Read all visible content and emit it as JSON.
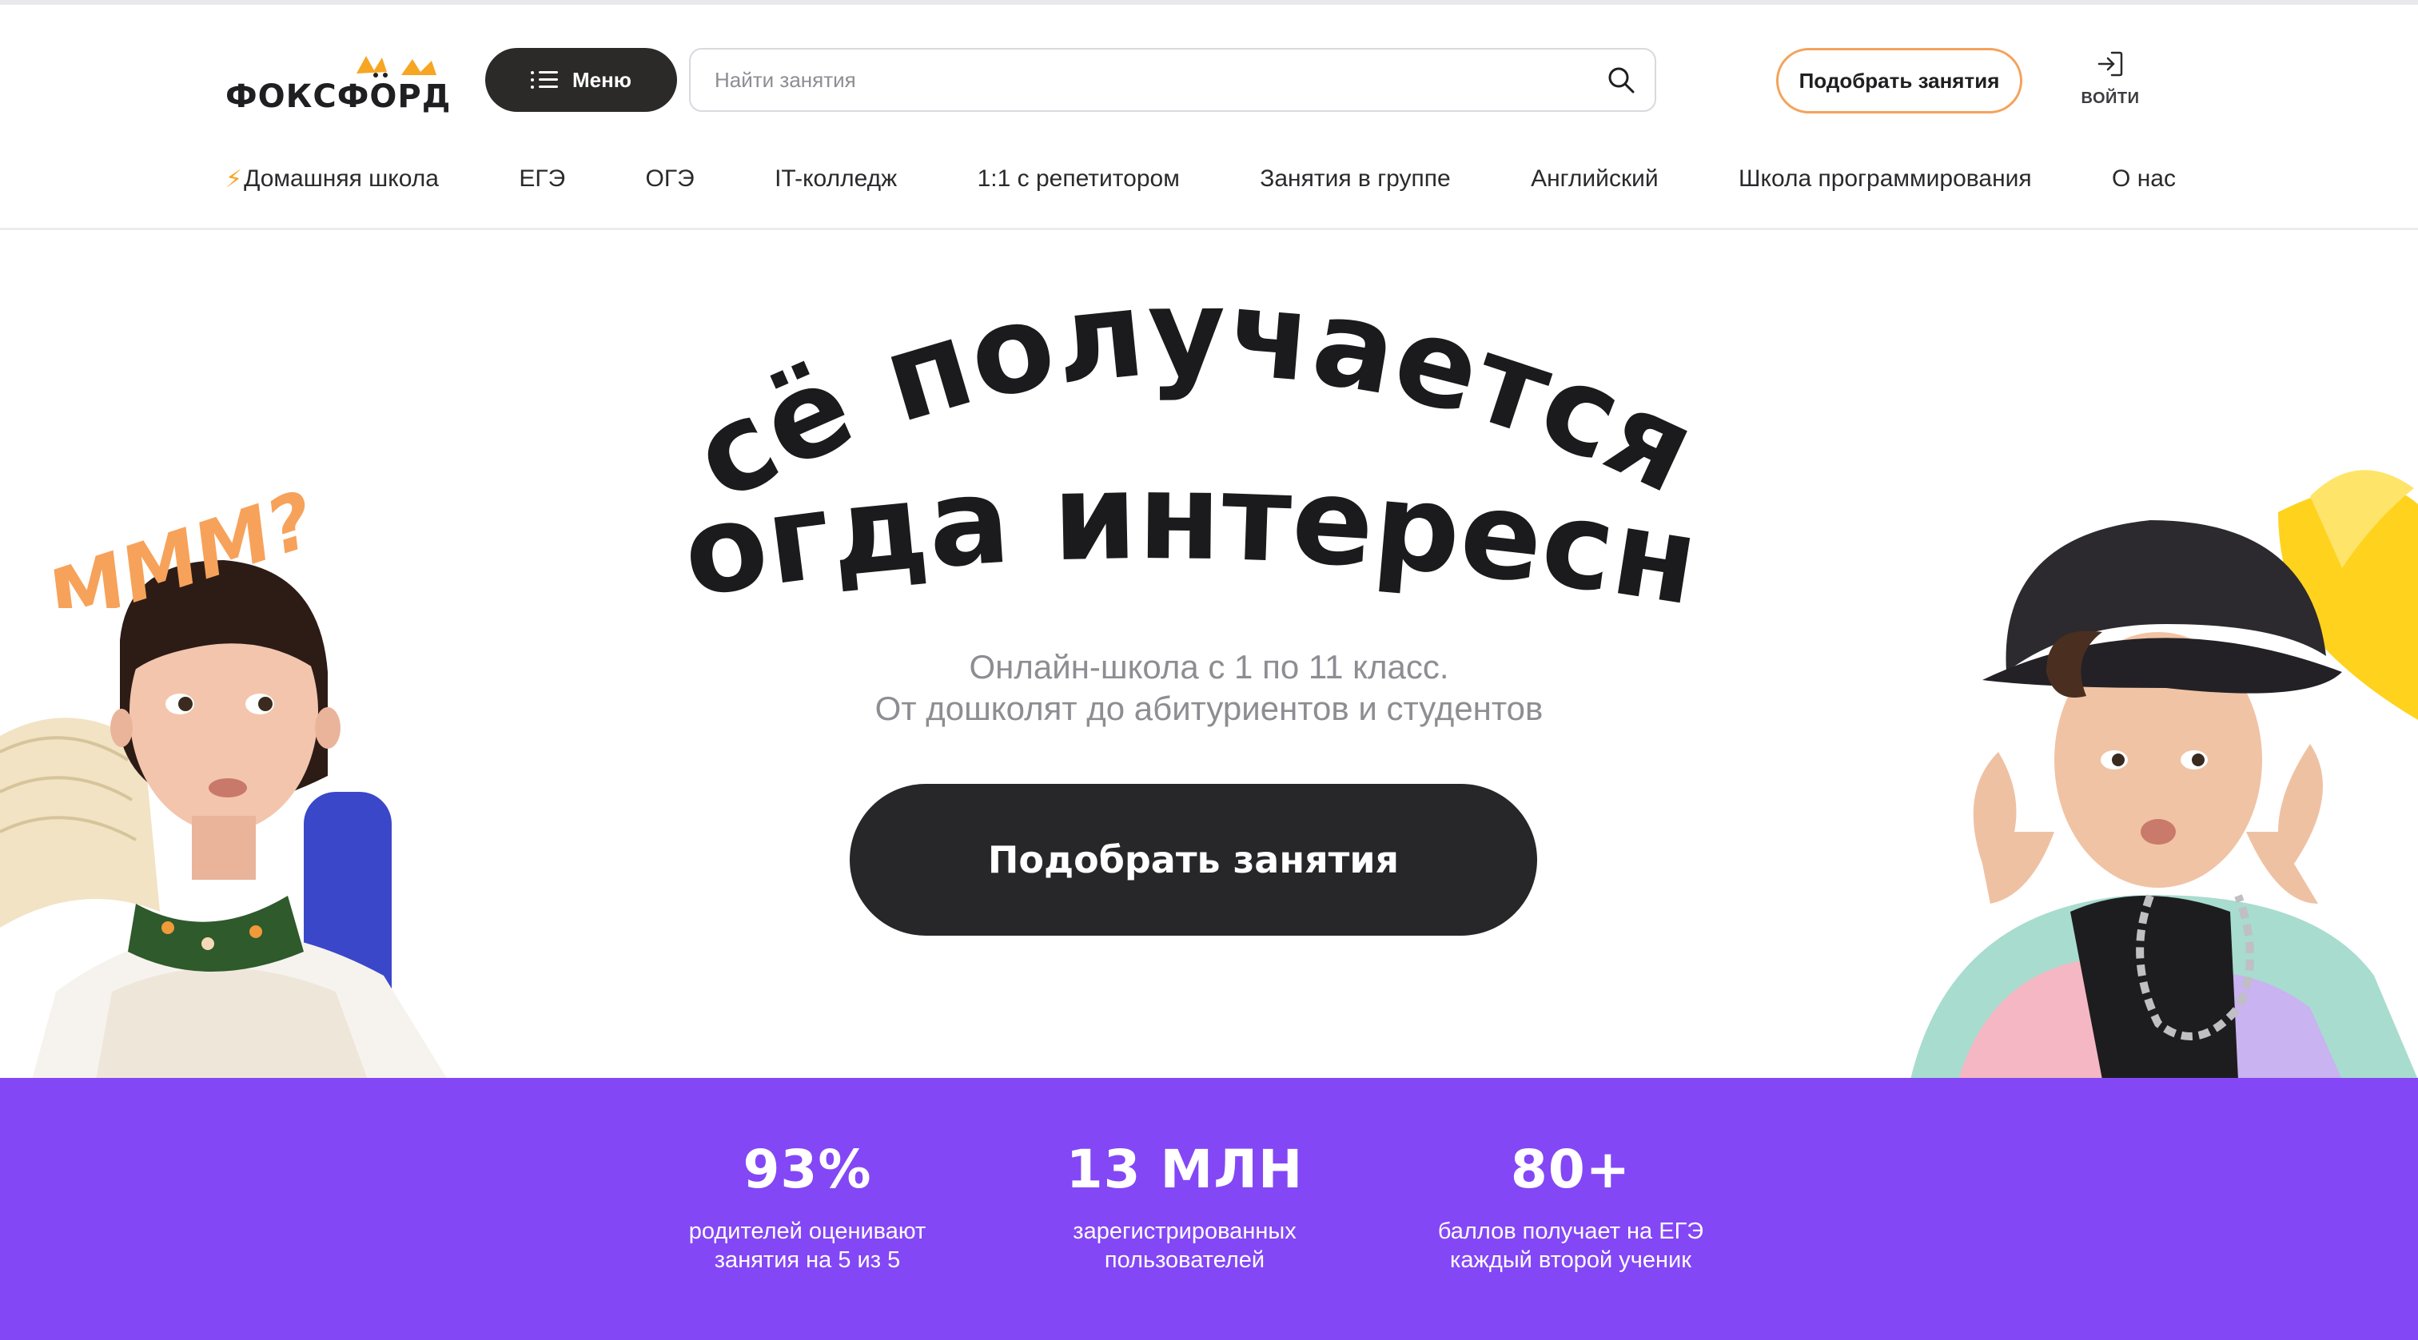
{
  "header": {
    "logo_text": "ФОКСФОРД",
    "menu_label": "Меню",
    "search": {
      "placeholder": "Найти занятия",
      "value": ""
    },
    "pick_button": "Подобрать занятия",
    "login_label": "ВОЙТИ"
  },
  "nav": {
    "items": [
      {
        "label": "Домашняя школа",
        "icon": "lightning-icon"
      },
      {
        "label": "ЕГЭ"
      },
      {
        "label": "ОГЭ"
      },
      {
        "label": "IT-колледж"
      },
      {
        "label": "1:1 с репетитором"
      },
      {
        "label": "Занятия в группе"
      },
      {
        "label": "Английский"
      },
      {
        "label": "Школа программирования"
      },
      {
        "label": "О нас"
      }
    ]
  },
  "hero": {
    "headline_line1": "всё получается,",
    "headline_line2": "когда интересно",
    "bubble_text": "МММ?",
    "subtitle_line1": "Онлайн-школа с 1 по 11 класс.",
    "subtitle_line2": "От дошколят до абитуриентов и студентов",
    "cta_label": "Подобрать занятия"
  },
  "stats": [
    {
      "value": "93%",
      "label_line1": "родителей оценивают",
      "label_line2": "занятия на 5 из 5"
    },
    {
      "value": "13 МЛН",
      "label_line1": "зарегистрированных",
      "label_line2": "пользователей"
    },
    {
      "value": "80+",
      "label_line1": "баллов получает на ЕГЭ",
      "label_line2": "каждый второй ученик"
    }
  ],
  "colors": {
    "brand_orange": "#f6a623",
    "accent_purple": "#8447f5",
    "dark": "#27272a"
  }
}
